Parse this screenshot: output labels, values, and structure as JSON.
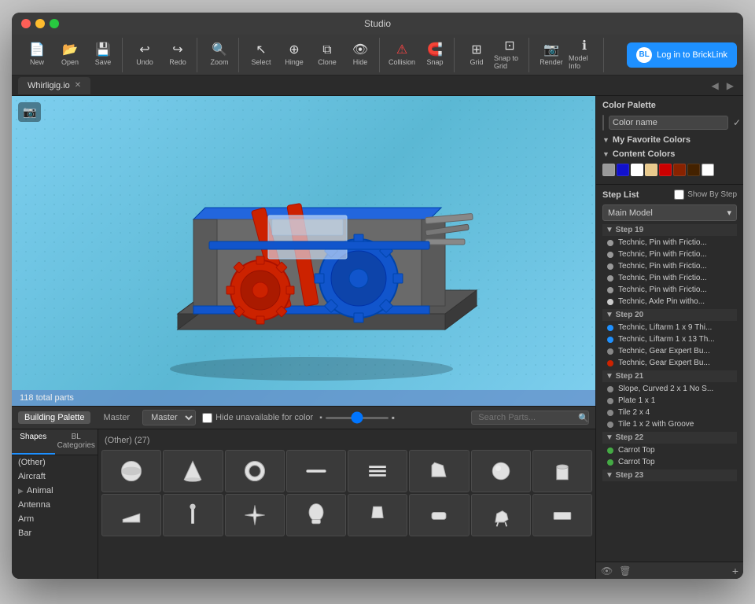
{
  "window": {
    "title": "Studio"
  },
  "toolbar": {
    "tools": [
      {
        "id": "new",
        "label": "New",
        "icon": "📄"
      },
      {
        "id": "open",
        "label": "Open",
        "icon": "📂"
      },
      {
        "id": "save",
        "label": "Save",
        "icon": "💾"
      },
      {
        "id": "undo",
        "label": "Undo",
        "icon": "↩"
      },
      {
        "id": "redo",
        "label": "Redo",
        "icon": "↪"
      },
      {
        "id": "zoom",
        "label": "Zoom",
        "icon": "🔍"
      },
      {
        "id": "select",
        "label": "Select",
        "icon": "↖"
      },
      {
        "id": "hinge",
        "label": "Hinge",
        "icon": "⊕"
      },
      {
        "id": "clone",
        "label": "Clone",
        "icon": "⧉"
      },
      {
        "id": "hide",
        "label": "Hide",
        "icon": "👁"
      },
      {
        "id": "collision",
        "label": "Collision",
        "icon": "⚠"
      },
      {
        "id": "snap",
        "label": "Snap",
        "icon": "🧲"
      },
      {
        "id": "grid",
        "label": "Grid",
        "icon": "⊞"
      },
      {
        "id": "snap_to_grid",
        "label": "Snap to Grid",
        "icon": "⊡"
      },
      {
        "id": "render",
        "label": "Render",
        "icon": "📷"
      },
      {
        "id": "model_info",
        "label": "Model Info",
        "icon": "ℹ"
      }
    ],
    "bricklink_btn": "Log in to BrickLink"
  },
  "tabs": [
    {
      "id": "whirligig",
      "label": "Whirligig.io",
      "active": true
    }
  ],
  "viewport": {
    "total_parts": "118 total parts"
  },
  "palette": {
    "tabs": [
      {
        "id": "building",
        "label": "Building Palette",
        "active": true
      },
      {
        "id": "master",
        "label": "Master"
      }
    ],
    "dropdown_value": "▾",
    "hide_unavailable_label": "Hide unavailable for color",
    "search_placeholder": "Search Parts...",
    "sidebar_tabs": [
      {
        "id": "shapes",
        "label": "Shapes",
        "active": true
      },
      {
        "id": "bl_cats",
        "label": "BL Categories"
      }
    ],
    "categories": [
      {
        "name": "(Other)",
        "hasArrow": false
      },
      {
        "name": "Aircraft",
        "hasArrow": false
      },
      {
        "name": "Animal",
        "hasArrow": true
      },
      {
        "name": "Antenna",
        "hasArrow": false
      },
      {
        "name": "Arm",
        "hasArrow": false
      },
      {
        "name": "Bar",
        "hasArrow": false
      }
    ],
    "section_title": "(Other) (27)",
    "parts": [
      {
        "shape": "sphere",
        "color": "#e8e8e8"
      },
      {
        "shape": "cone",
        "color": "#e8e8e8"
      },
      {
        "shape": "donut",
        "color": "#e8e8e8"
      },
      {
        "shape": "rod",
        "color": "#e8e8e8"
      },
      {
        "shape": "connector",
        "color": "#e8e8e8"
      },
      {
        "shape": "bracket",
        "color": "#e8e8e8"
      },
      {
        "shape": "sphere2",
        "color": "#e8e8e8"
      },
      {
        "shape": "cylinder",
        "color": "#e8e8e8"
      },
      {
        "shape": "wedge",
        "color": "#e8e8e8"
      },
      {
        "shape": "pin",
        "color": "#e8e8e8"
      },
      {
        "shape": "axle",
        "color": "#e8e8e8"
      },
      {
        "shape": "head",
        "color": "#e8e8e8"
      },
      {
        "shape": "torso",
        "color": "#e8e8e8"
      },
      {
        "shape": "arm2",
        "color": "#e8e8e8"
      },
      {
        "shape": "horse",
        "color": "#e8e8e8"
      },
      {
        "shape": "flat",
        "color": "#e8e8e8"
      }
    ]
  },
  "right_panel": {
    "color_palette": {
      "title": "Color Palette",
      "color_name": "Color name",
      "my_favorite": "My Favorite Colors",
      "content_colors": "Content Colors",
      "swatches": [
        "#999999",
        "#1111cc",
        "#ffffff",
        "#ffaa00",
        "#cc0000",
        "#882200",
        "#442200",
        "#ffffff"
      ]
    },
    "step_list": {
      "title": "Step List",
      "show_by_step": "Show By Step",
      "model": "Main Model",
      "steps": [
        {
          "id": "step19",
          "label": "Step 19",
          "items": [
            {
              "label": "Technic, Pin with Frictio...",
              "color": "#999999"
            },
            {
              "label": "Technic, Pin with Frictio...",
              "color": "#999999"
            },
            {
              "label": "Technic, Pin with Frictio...",
              "color": "#999999"
            },
            {
              "label": "Technic, Pin with Frictio...",
              "color": "#999999"
            },
            {
              "label": "Technic, Pin with Frictio...",
              "color": "#999999"
            },
            {
              "label": "Technic, Axle Pin witho...",
              "color": "#cccccc"
            }
          ]
        },
        {
          "id": "step20",
          "label": "Step 20",
          "items": [
            {
              "label": "Technic, Liftarm 1 x 9 Thi...",
              "color": "#1e90ff"
            },
            {
              "label": "Technic, Liftarm 1 x 13 Th...",
              "color": "#1e90ff"
            },
            {
              "label": "Technic, Gear Expert Bu...",
              "color": "#888888"
            },
            {
              "label": "Technic, Gear Expert Bu...",
              "color": "#cc2200"
            }
          ]
        },
        {
          "id": "step21",
          "label": "Step 21",
          "items": [
            {
              "label": "Slope, Curved 2 x 1 No S...",
              "color": "#888888"
            },
            {
              "label": "Plate 1 x 1",
              "color": "#888888"
            },
            {
              "label": "Tile 2 x 4",
              "color": "#888888"
            },
            {
              "label": "Tile 1 x 2 with Groove",
              "color": "#888888"
            }
          ]
        },
        {
          "id": "step22",
          "label": "Step 22",
          "items": [
            {
              "label": "Carrot Top",
              "color": "#44aa44"
            },
            {
              "label": "Carrot Top",
              "color": "#44aa44"
            }
          ]
        },
        {
          "id": "step23",
          "label": "Step 23",
          "items": []
        }
      ]
    }
  }
}
